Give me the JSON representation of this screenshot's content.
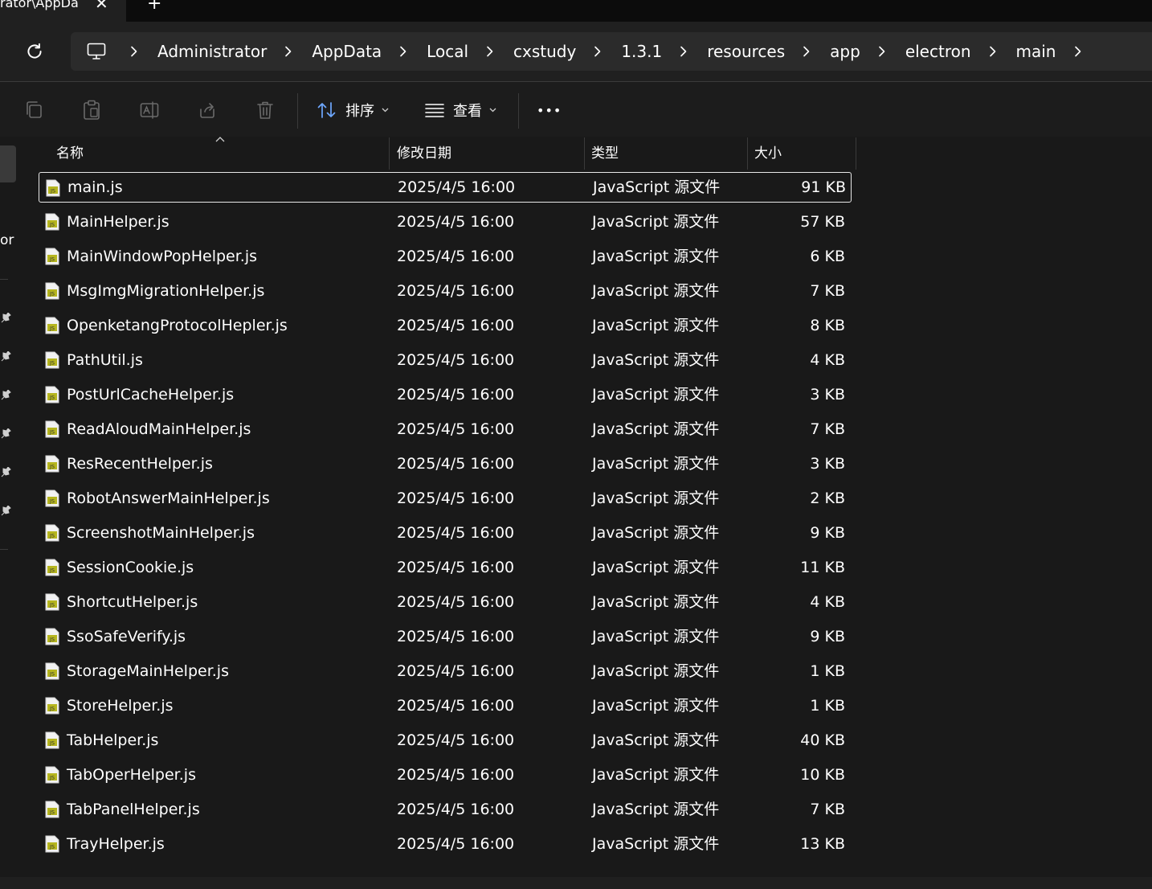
{
  "tab": {
    "title": "rator\\AppDa",
    "close": "✕",
    "add": "+"
  },
  "breadcrumb": [
    "Administrator",
    "AppData",
    "Local",
    "cxstudy",
    "1.3.1",
    "resources",
    "app",
    "electron",
    "main"
  ],
  "toolbar": {
    "sort_label": "排序",
    "view_label": "查看",
    "more_label": "•••"
  },
  "nav": {
    "fragment": "or"
  },
  "columns": {
    "name": "名称",
    "date": "修改日期",
    "type": "类型",
    "size": "大小"
  },
  "files": [
    {
      "name": "main.js",
      "date": "2025/4/5 16:00",
      "type": "JavaScript 源文件",
      "size": "91 KB",
      "selected": true
    },
    {
      "name": "MainHelper.js",
      "date": "2025/4/5 16:00",
      "type": "JavaScript 源文件",
      "size": "57 KB"
    },
    {
      "name": "MainWindowPopHelper.js",
      "date": "2025/4/5 16:00",
      "type": "JavaScript 源文件",
      "size": "6 KB"
    },
    {
      "name": "MsgImgMigrationHelper.js",
      "date": "2025/4/5 16:00",
      "type": "JavaScript 源文件",
      "size": "7 KB"
    },
    {
      "name": "OpenketangProtocolHepler.js",
      "date": "2025/4/5 16:00",
      "type": "JavaScript 源文件",
      "size": "8 KB"
    },
    {
      "name": "PathUtil.js",
      "date": "2025/4/5 16:00",
      "type": "JavaScript 源文件",
      "size": "4 KB"
    },
    {
      "name": "PostUrlCacheHelper.js",
      "date": "2025/4/5 16:00",
      "type": "JavaScript 源文件",
      "size": "3 KB"
    },
    {
      "name": "ReadAloudMainHelper.js",
      "date": "2025/4/5 16:00",
      "type": "JavaScript 源文件",
      "size": "7 KB"
    },
    {
      "name": "ResRecentHelper.js",
      "date": "2025/4/5 16:00",
      "type": "JavaScript 源文件",
      "size": "3 KB"
    },
    {
      "name": "RobotAnswerMainHelper.js",
      "date": "2025/4/5 16:00",
      "type": "JavaScript 源文件",
      "size": "2 KB"
    },
    {
      "name": "ScreenshotMainHelper.js",
      "date": "2025/4/5 16:00",
      "type": "JavaScript 源文件",
      "size": "9 KB"
    },
    {
      "name": "SessionCookie.js",
      "date": "2025/4/5 16:00",
      "type": "JavaScript 源文件",
      "size": "11 KB"
    },
    {
      "name": "ShortcutHelper.js",
      "date": "2025/4/5 16:00",
      "type": "JavaScript 源文件",
      "size": "4 KB"
    },
    {
      "name": "SsoSafeVerify.js",
      "date": "2025/4/5 16:00",
      "type": "JavaScript 源文件",
      "size": "9 KB"
    },
    {
      "name": "StorageMainHelper.js",
      "date": "2025/4/5 16:00",
      "type": "JavaScript 源文件",
      "size": "1 KB"
    },
    {
      "name": "StoreHelper.js",
      "date": "2025/4/5 16:00",
      "type": "JavaScript 源文件",
      "size": "1 KB"
    },
    {
      "name": "TabHelper.js",
      "date": "2025/4/5 16:00",
      "type": "JavaScript 源文件",
      "size": "40 KB"
    },
    {
      "name": "TabOperHelper.js",
      "date": "2025/4/5 16:00",
      "type": "JavaScript 源文件",
      "size": "10 KB"
    },
    {
      "name": "TabPanelHelper.js",
      "date": "2025/4/5 16:00",
      "type": "JavaScript 源文件",
      "size": "7 KB"
    },
    {
      "name": "TrayHelper.js",
      "date": "2025/4/5 16:00",
      "type": "JavaScript 源文件",
      "size": "13 KB"
    }
  ],
  "icons": {
    "refresh": "refresh-icon",
    "computer": "computer-icon",
    "chevron": "chevron-right-icon",
    "copy": "copy-icon",
    "paste": "paste-icon",
    "rename": "rename-icon",
    "share": "share-icon",
    "delete": "delete-icon",
    "sort": "sort-icon",
    "view": "view-icon",
    "file": "js-file-icon",
    "pin": "pin-icon"
  },
  "colors": {
    "background": "#191919",
    "toolbar": "#1c1c1c",
    "addressbar": "#2b2b2b",
    "text": "#ffffff",
    "file_icon": "#b5b51e"
  }
}
